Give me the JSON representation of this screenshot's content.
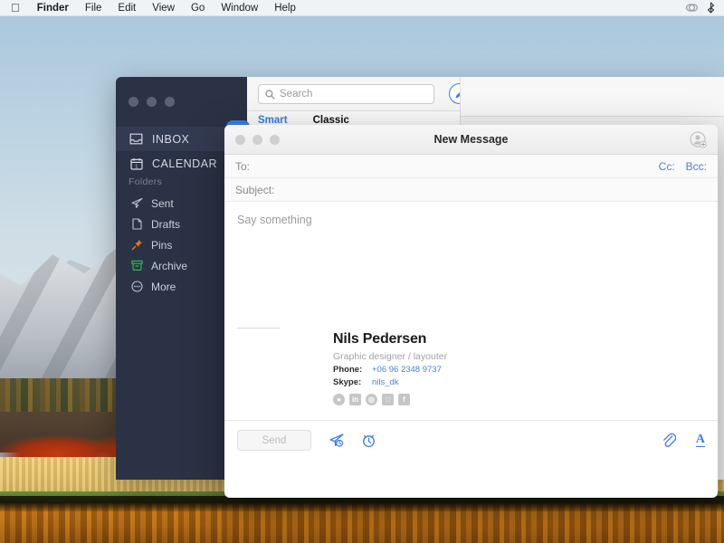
{
  "menubar": {
    "apple_icon": "apple-logo",
    "items": [
      {
        "label": "Finder",
        "bold": true
      },
      {
        "label": "File",
        "bold": false
      },
      {
        "label": "Edit",
        "bold": false
      },
      {
        "label": "View",
        "bold": false
      },
      {
        "label": "Go",
        "bold": false
      },
      {
        "label": "Window",
        "bold": false
      },
      {
        "label": "Help",
        "bold": false
      }
    ],
    "right_icons": [
      "dropbox-icon",
      "bluetooth-icon"
    ]
  },
  "mail_window": {
    "sidebar": {
      "traffic_lights": [
        "close",
        "minimize",
        "maximize"
      ],
      "refresh_icon": "refresh-icon",
      "nav": [
        {
          "label": "INBOX",
          "icon": "inbox-icon",
          "active": true
        },
        {
          "label": "CALENDAR",
          "icon": "calendar-icon",
          "active": false
        }
      ],
      "section_label": "Folders",
      "folders": [
        {
          "label": "Sent",
          "icon": "paper-plane-icon",
          "color": "#b9bfcc"
        },
        {
          "label": "Drafts",
          "icon": "document-icon",
          "color": "#b9bfcc"
        },
        {
          "label": "Pins",
          "icon": "pin-icon",
          "color": "#e8791f"
        },
        {
          "label": "Archive",
          "icon": "archive-box-icon",
          "color": "#2fb84f"
        },
        {
          "label": "More",
          "icon": "ellipsis-circle-icon",
          "color": "#b9bfcc"
        }
      ]
    },
    "list": {
      "search_placeholder": "Search",
      "search_value": "",
      "search_icon": "search-icon",
      "compose_icon": "pencil-icon",
      "tabs": [
        {
          "label": "Smart",
          "selected": true
        },
        {
          "label": "Classic",
          "selected": false
        }
      ]
    }
  },
  "new_message": {
    "title": "New Message",
    "traffic_lights": [
      "close",
      "minimize",
      "maximize"
    ],
    "add_contact_icon": "add-contact-icon",
    "to_label": "To:",
    "to_value": "",
    "cc_label": "Cc:",
    "bcc_label": "Bcc:",
    "subject_label": "Subject:",
    "subject_value": "",
    "body_placeholder": "Say something",
    "signature": {
      "name": "Nils Pedersen",
      "role": "Graphic designer / layouter",
      "phone_label": "Phone:",
      "phone_value": "+06 96 2348 9737",
      "skype_label": "Skype:",
      "skype_value": "nils_dk",
      "socials": [
        "behance-icon",
        "linkedin-icon",
        "dribbble-icon",
        "instagram-icon",
        "facebook-icon"
      ]
    },
    "toolbar": {
      "send_label": "Send",
      "send_enabled": false,
      "send_later_icon": "send-later-icon",
      "snooze_icon": "alarm-clock-icon",
      "attach_icon": "paperclip-icon",
      "format_icon": "text-format-icon",
      "format_glyph": "A"
    }
  },
  "theme": {
    "accent_blue": "#3b7ddd",
    "sidebar_bg": "#2b3245",
    "sidebar_active_bg": "#333b50",
    "link_blue": "#4a7fd4",
    "pin_orange": "#e8791f",
    "archive_green": "#2fb84f"
  }
}
